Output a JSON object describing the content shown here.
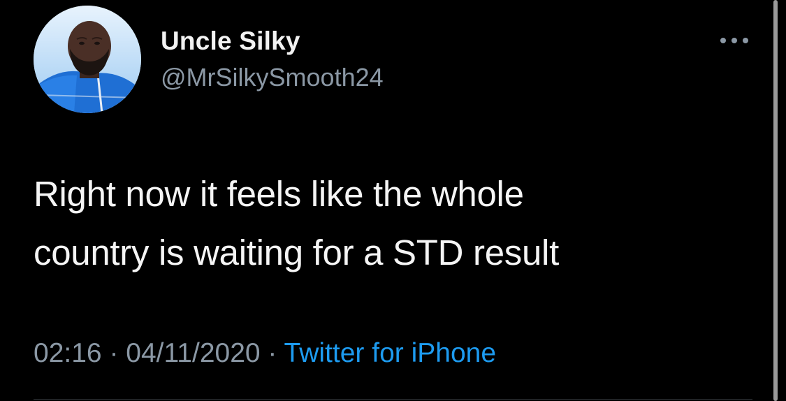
{
  "tweet": {
    "author": {
      "display_name": "Uncle Silky",
      "handle": "@MrSilkySmooth24",
      "avatar_icon": "profile-photo"
    },
    "more_icon": "more-options-icon",
    "text_line1": "Right now it feels like the whole",
    "text_line2": "country is waiting for a STD result",
    "time": "02:16",
    "separator": " · ",
    "date": "04/11/2020",
    "source": "Twitter for iPhone"
  },
  "colors": {
    "background": "#000000",
    "secondary_text": "#8b98a5",
    "link": "#1d9bf0"
  }
}
